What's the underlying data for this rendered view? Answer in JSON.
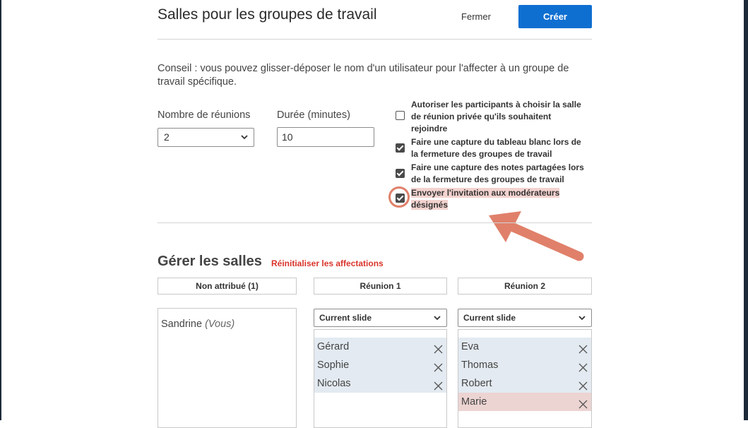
{
  "header": {
    "title": "Salles pour les groupes de travail",
    "close_label": "Fermer",
    "create_label": "Créer"
  },
  "tip": "Conseil : vous pouvez glisser-déposer le nom d'un utilisateur pour l'affecter à un groupe de travail spécifique.",
  "form": {
    "rooms_label": "Nombre de réunions",
    "rooms_value": "2",
    "duration_label": "Durée (minutes)",
    "duration_value": "10"
  },
  "options": [
    {
      "label": "Autoriser les participants à choisir la salle de réunion privée qu'ils souhaitent rejoindre",
      "checked": false
    },
    {
      "label": "Faire une capture du tableau blanc lors de la fermeture des groupes de travail",
      "checked": true
    },
    {
      "label": "Faire une capture des notes partagées lors de la fermeture des groupes de travail",
      "checked": true
    },
    {
      "label": "Envoyer l'invitation aux modérateurs désignés",
      "checked": true
    }
  ],
  "manage": {
    "title": "Gérer les salles",
    "reset_label": "Réinitialiser les affectations",
    "unassigned": {
      "header": "Non attribué (1)",
      "user_name": "Sandrine",
      "user_tag": "(Vous)"
    },
    "rooms": [
      {
        "header": "Réunion 1",
        "slide": "Current slide",
        "members": [
          "Gérard",
          "Sophie",
          "Nicolas"
        ]
      },
      {
        "header": "Réunion 2",
        "slide": "Current slide",
        "members": [
          "Eva",
          "Thomas",
          "Robert",
          "Marie"
        ]
      }
    ]
  },
  "colors": {
    "primary": "#0f6fd1",
    "danger": "#d9342b",
    "highlight": "#f3d3cf",
    "annotation": "#e0806a",
    "member_bg": "#e3eaf1"
  }
}
